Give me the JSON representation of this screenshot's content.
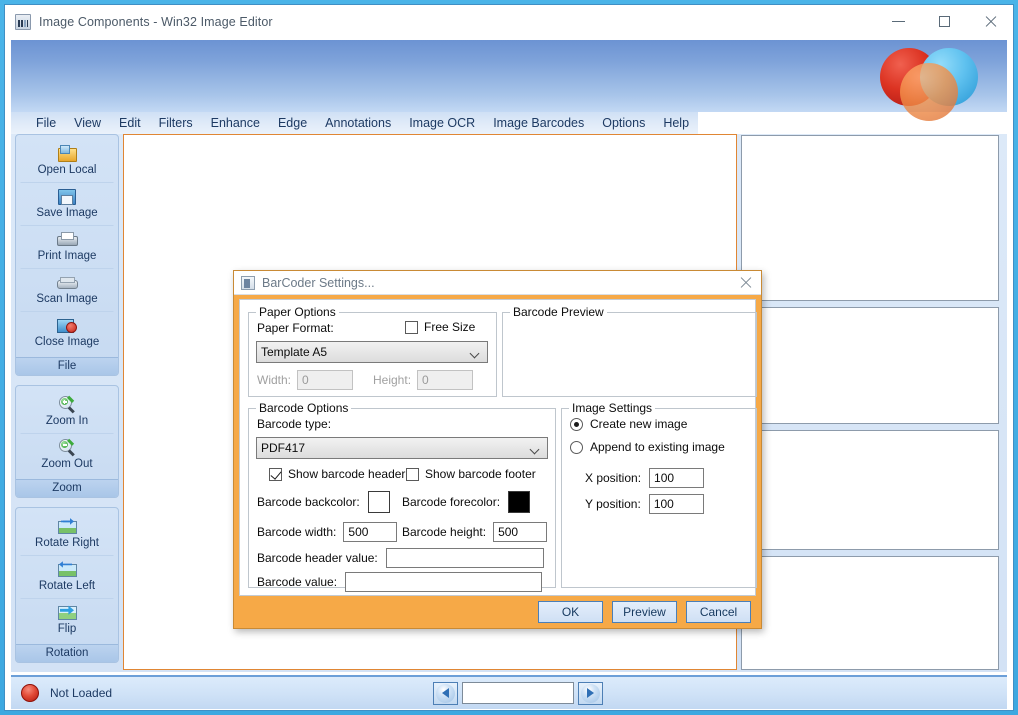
{
  "window": {
    "title": "Image Components - Win32 Image Editor",
    "controls": {
      "minimize": "–",
      "maximize": "□",
      "close": "✕"
    }
  },
  "menubar": {
    "items": [
      {
        "label": "File"
      },
      {
        "label": "View"
      },
      {
        "label": "Edit"
      },
      {
        "label": "Filters"
      },
      {
        "label": "Enhance"
      },
      {
        "label": "Edge"
      },
      {
        "label": "Annotations"
      },
      {
        "label": "Image OCR"
      },
      {
        "label": "Image Barcodes"
      },
      {
        "label": "Options"
      },
      {
        "label": "Help"
      }
    ]
  },
  "sidebar": {
    "groups": [
      {
        "title": "File",
        "buttons": [
          {
            "label": "Open Local",
            "icon": "open-folder-icon"
          },
          {
            "label": "Save Image",
            "icon": "save-disk-icon"
          },
          {
            "label": "Print Image",
            "icon": "printer-icon"
          },
          {
            "label": "Scan Image",
            "icon": "scanner-icon"
          },
          {
            "label": "Close Image",
            "icon": "close-image-icon"
          }
        ]
      },
      {
        "title": "Zoom",
        "buttons": [
          {
            "label": "Zoom In",
            "icon": "zoom-in-icon"
          },
          {
            "label": "Zoom Out",
            "icon": "zoom-out-icon"
          }
        ]
      },
      {
        "title": "Rotation",
        "buttons": [
          {
            "label": "Rotate Right",
            "icon": "rotate-right-icon"
          },
          {
            "label": "Rotate Left",
            "icon": "rotate-left-icon"
          },
          {
            "label": "Flip",
            "icon": "flip-icon"
          }
        ]
      }
    ]
  },
  "statusbar": {
    "status_icon": "red-circle-status-icon",
    "status_text": "Not Loaded",
    "prev_icon": "arrow-left-icon",
    "next_icon": "arrow-right-icon",
    "page_input_value": "",
    "page_input_placeholder": ""
  },
  "logo": {
    "name": "overlapping-circles-logo",
    "colors": {
      "red": "#d93025",
      "blue": "#5bb8ec",
      "orange": "#f08a3c"
    }
  },
  "dialog": {
    "title": "BarCoder Settings...",
    "icon": "barcode-document-icon",
    "close_icon": "close-icon",
    "paper_options": {
      "legend": "Paper Options",
      "paper_format_label": "Paper Format:",
      "free_size_label": "Free Size",
      "free_size_checked": false,
      "paper_format_value": "Template A5",
      "paper_format_options": [
        "Template A5"
      ],
      "width_label": "Width:",
      "width_value": "0",
      "width_disabled": true,
      "height_label": "Height:",
      "height_value": "0",
      "height_disabled": true
    },
    "barcode_preview": {
      "legend": "Barcode Preview",
      "content": ""
    },
    "barcode_options": {
      "legend": "Barcode Options",
      "type_label": "Barcode type:",
      "type_value": "PDF417",
      "type_options": [
        "PDF417"
      ],
      "show_header_label": "Show barcode header",
      "show_header_checked": true,
      "show_footer_label": "Show barcode footer",
      "show_footer_checked": false,
      "backcolor_label": "Barcode backcolor:",
      "backcolor_value": "#ffffff",
      "forecolor_label": "Barcode forecolor:",
      "forecolor_value": "#000000",
      "width_label": "Barcode width:",
      "width_value": "500",
      "height_label": "Barcode height:",
      "height_value": "500",
      "header_value_label": "Barcode header value:",
      "header_value": "",
      "value_label": "Barcode value:",
      "value": ""
    },
    "image_settings": {
      "legend": "Image Settings",
      "create_new_label": "Create new image",
      "create_new_selected": true,
      "append_existing_label": "Append to existing image",
      "append_existing_selected": false,
      "x_position_label": "X position:",
      "x_position_value": "100",
      "y_position_label": "Y position:",
      "y_position_value": "100"
    },
    "buttons": {
      "ok": "OK",
      "preview": "Preview",
      "cancel": "Cancel"
    }
  }
}
